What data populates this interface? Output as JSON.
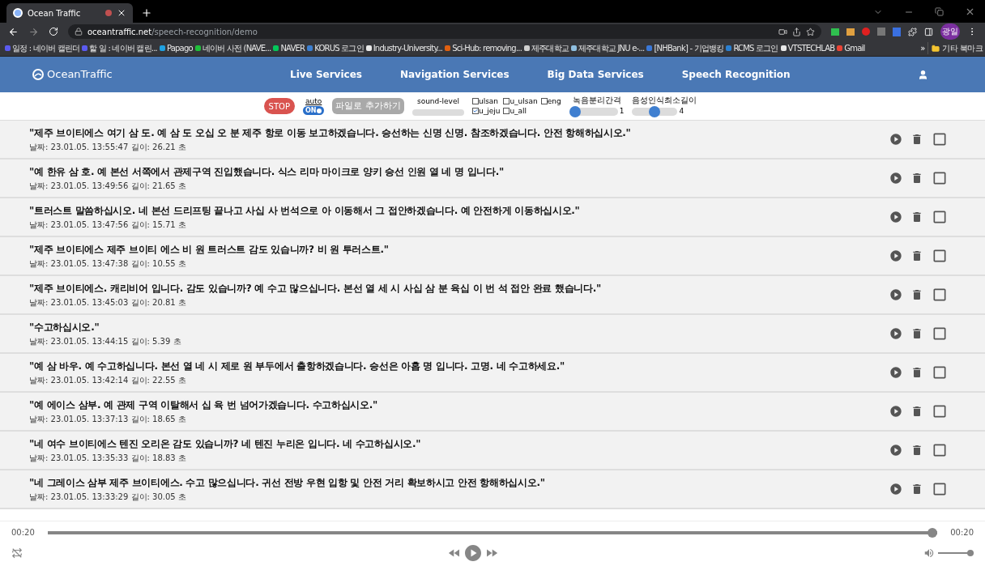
{
  "browser": {
    "tab": {
      "title": "Ocean Traffic",
      "selected": true
    },
    "url": {
      "domain": "oceantraffic.net",
      "path": "/speech-recognition/demo"
    },
    "profile": "광일",
    "bookmarks": [
      {
        "label": "일정 : 네이버 캘린더",
        "color": "#5b5bf0"
      },
      {
        "label": "할 일 : 네이버 캘린...",
        "color": "#5b5bf0"
      },
      {
        "label": "Papago",
        "color": "#1fa0e0"
      },
      {
        "label": "네이버 사전 (NAVE...",
        "color": "#1fbf3a"
      },
      {
        "label": "NAVER",
        "color": "#03c75a"
      },
      {
        "label": "KORUS 로그인",
        "color": "#3c7fd0"
      },
      {
        "label": "Industry-University...",
        "color": "#e8e8e8"
      },
      {
        "label": "Sci-Hub: removing...",
        "color": "#e06010"
      },
      {
        "label": "제주대학교",
        "color": "#d0d0d0"
      },
      {
        "label": "제주대학교 JNU e-...",
        "color": "#8fbfe0"
      },
      {
        "label": "[NHBank] - 기업뱅킹",
        "color": "#3a78d8"
      },
      {
        "label": "RCMS 로그인",
        "color": "#2a7fd0"
      },
      {
        "label": "VTSTECHLAB",
        "color": "#e8e8e8"
      },
      {
        "label": "Gmail",
        "color": "#ea4335"
      }
    ],
    "more": "»",
    "other_bookmarks": "기타 북마크"
  },
  "nav": {
    "logo": "OceanTraffic",
    "links": [
      {
        "label": "Live Services",
        "selected": false
      },
      {
        "label": "Navigation Services",
        "selected": false
      },
      {
        "label": "Big Data Services",
        "selected": false
      },
      {
        "label": "Speech Recognition",
        "selected": false
      }
    ]
  },
  "controls": {
    "stop": "STOP",
    "auto": {
      "label": "auto",
      "toggle": "ON",
      "on": true
    },
    "add_file": "파일로 추가하기",
    "add_file_disabled": true,
    "sound_level": {
      "label": "sound-level",
      "level": 0
    },
    "models": [
      {
        "label": "ulsan",
        "checked": false
      },
      {
        "label": "u_jeju",
        "checked": true
      },
      {
        "label": "u_ulsan",
        "checked": false
      },
      {
        "label": "u_all",
        "checked": false
      },
      {
        "label": "eng",
        "checked": false
      }
    ],
    "sliders": [
      {
        "label": "녹음분리간격",
        "level": 0,
        "reading": "1"
      },
      {
        "label": "음성인식최소길이",
        "level": 0.5,
        "reading": "4"
      }
    ]
  },
  "records": [
    {
      "text": "\"제주 브이티에스 여기 삼 도. 예 삼 도 오십 오 분 제주 항로 이동 보고하겠습니다. 승선하는 신명 신명. 참조하겠습니다. 안전 항해하십시오.\"",
      "meta": "날짜: 23.01.05. 13:55:47 길이: 26.21 초",
      "checked": false
    },
    {
      "text": "\"예 한유 삼 호. 예 본선 서쪽에서 관제구역 진입했습니다. 식스 리마 마이크로 양키 승선 인원 열 네 명 입니다.\"",
      "meta": "날짜: 23.01.05. 13:49:56 길이: 21.65 초",
      "checked": false
    },
    {
      "text": "\"트러스트 말씀하십시오. 네 본선 드리프팅 끝나고 사십 사 번석으로 아 이동해서 그 접안하겠습니다. 예 안전하게 이동하십시오.\"",
      "meta": "날짜: 23.01.05. 13:47:56 길이: 15.71 초",
      "checked": false
    },
    {
      "text": "\"제주 브이티에스 제주 브이티 에스 비 원 트러스트 감도 있습니까? 비 원 투러스트.\"",
      "meta": "날짜: 23.01.05. 13:47:38 길이: 10.55 초",
      "checked": false
    },
    {
      "text": "\"제주 브이티에스. 캐리비어 입니다. 감도 있습니까? 예 수고 많으십니다. 본선 열 세 시 사십 삼 분 육십 이 번 석 접안 완료 했습니다.\"",
      "meta": "날짜: 23.01.05. 13:45:03 길이: 20.81 초",
      "checked": false
    },
    {
      "text": "\"수고하십시오.\"",
      "meta": "날짜: 23.01.05. 13:44:15 길이: 5.39 초",
      "checked": false
    },
    {
      "text": "\"예 삼 바우. 예 수고하십니다. 본선 열 네 시 제로 원 부두에서 출항하겠습니다. 승선은 아홉 명 입니다. 고명. 네 수고하세요.\"",
      "meta": "날짜: 23.01.05. 13:42:14 길이: 22.55 초",
      "checked": false
    },
    {
      "text": "\"예 에이스 삼부. 예 관제 구역 이탈해서 십 육 번 넘어가겠습니다. 수고하십시오.\"",
      "meta": "날짜: 23.01.05. 13:37:13 길이: 18.65 초",
      "checked": false
    },
    {
      "text": "\"네 여수 브이티에스 텐진 오리온 감도 있습니까? 네 텐진 누리온 입니다. 네 수고하십시오.\"",
      "meta": "날짜: 23.01.05. 13:35:33 길이: 18.83 초",
      "checked": false
    },
    {
      "text": "\"네 그레이스 삼부 제주 브이티에스. 수고 많으십니다. 귀선 전방 우현 입항 및 안전 거리 확보하시고 안전 항해하십시오.\"",
      "meta": "날짜: 23.01.05. 13:33:29 길이: 30.05 초",
      "checked": false
    }
  ],
  "player": {
    "current": "00:20",
    "duration": "00:20",
    "level": 1,
    "volume": {
      "level": 1
    }
  }
}
